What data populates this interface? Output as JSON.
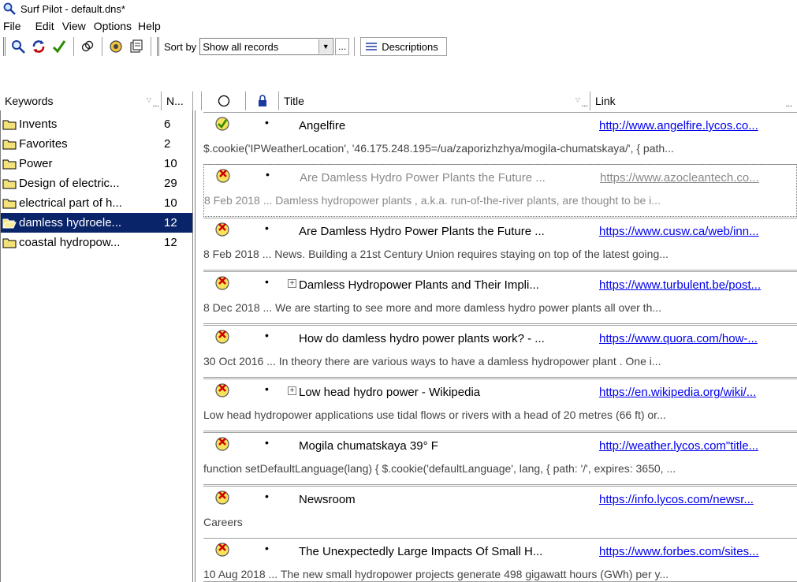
{
  "window": {
    "title": "Surf Pilot - default.dns*"
  },
  "menu": [
    "File",
    "Edit",
    "View",
    "Options",
    "Help"
  ],
  "toolbar": {
    "sort_label": "Sort by",
    "sort_value": "Show all records",
    "dots_label": "...",
    "descriptions_label": "Descriptions"
  },
  "left_header": {
    "keywords": "Keywords",
    "count": "N...",
    "ellipsis": "..."
  },
  "keywords": [
    {
      "label": "Invents",
      "count": "6"
    },
    {
      "label": "Favorites",
      "count": "2"
    },
    {
      "label": "Power",
      "count": "10"
    },
    {
      "label": "Design of electric...",
      "count": "29"
    },
    {
      "label": "electrical part of h...",
      "count": "10"
    },
    {
      "label": "damless hydroele...",
      "count": "12"
    },
    {
      "label": "coastal hydropow...",
      "count": "12"
    }
  ],
  "right_header": {
    "title": "Title",
    "link": "Link",
    "ellipsis": "..."
  },
  "records": [
    {
      "title": "Angelfire",
      "link": "http://www.angelfire.lycos.co...",
      "desc": "$.cookie('IPWeatherLocation', '46.175.248.195=/ua/zaporizhzhya/mogila-chumatskaya/', { path...",
      "status": "check",
      "expand": false,
      "dimmed": false
    },
    {
      "title": "Are Damless Hydro Power Plants the Future ...",
      "link": "https://www.azocleantech.co...",
      "desc": "8 Feb 2018  ...   Damless hydropower plants  , a.k.a. run-of-the-river plants, are thought to be i...",
      "status": "x",
      "expand": false,
      "dimmed": true
    },
    {
      "title": "Are Damless Hydro Power Plants the Future ...",
      "link": "https://www.cusw.ca/web/inn...",
      "desc": "8 Feb 2018  ...  News. Building a 21st Century Union requires staying on top of the latest going...",
      "status": "x",
      "expand": false,
      "dimmed": false
    },
    {
      "title": "Damless Hydropower Plants and Their Impli...",
      "link": "https://www.turbulent.be/post...",
      "desc": "8 Dec 2018  ...  We are starting to see more and more  damless hydro power plants  all over th...",
      "status": "x",
      "expand": true,
      "dimmed": false
    },
    {
      "title": "How do damless hydro power plants work? - ...",
      "link": "https://www.quora.com/how-...",
      "desc": "30 Oct 2016  ...  In theory there are various ways to have a  damless hydropower plant  . One i...",
      "status": "x",
      "expand": false,
      "dimmed": false
    },
    {
      "title": "Low head hydro power - Wikipedia",
      "link": "https://en.wikipedia.org/wiki/...",
      "desc": "Low head  hydropower  applications use tidal flows or rivers with a head of 20  metres (66 ft) or...",
      "status": "x",
      "expand": true,
      "dimmed": false
    },
    {
      "title": "Mogila chumatskaya 39° F",
      "link": "http://weather.lycos.com\"title...",
      "desc": "function setDefaultLanguage(lang) { $.cookie('defaultLanguage', lang, { path: '/', expires: 3650, ...",
      "status": "x",
      "expand": false,
      "dimmed": false
    },
    {
      "title": "Newsroom",
      "link": "https://info.lycos.com/newsr...",
      "desc": "Careers",
      "status": "x",
      "expand": false,
      "dimmed": false
    },
    {
      "title": "The Unexpectedly Large Impacts Of Small H...",
      "link": "https://www.forbes.com/sites...",
      "desc": "10 Aug 2018  ...  The new small  hydropower  projects generate 498 gigawatt hours (GWh) per y...",
      "status": "x",
      "expand": false,
      "dimmed": false
    }
  ]
}
